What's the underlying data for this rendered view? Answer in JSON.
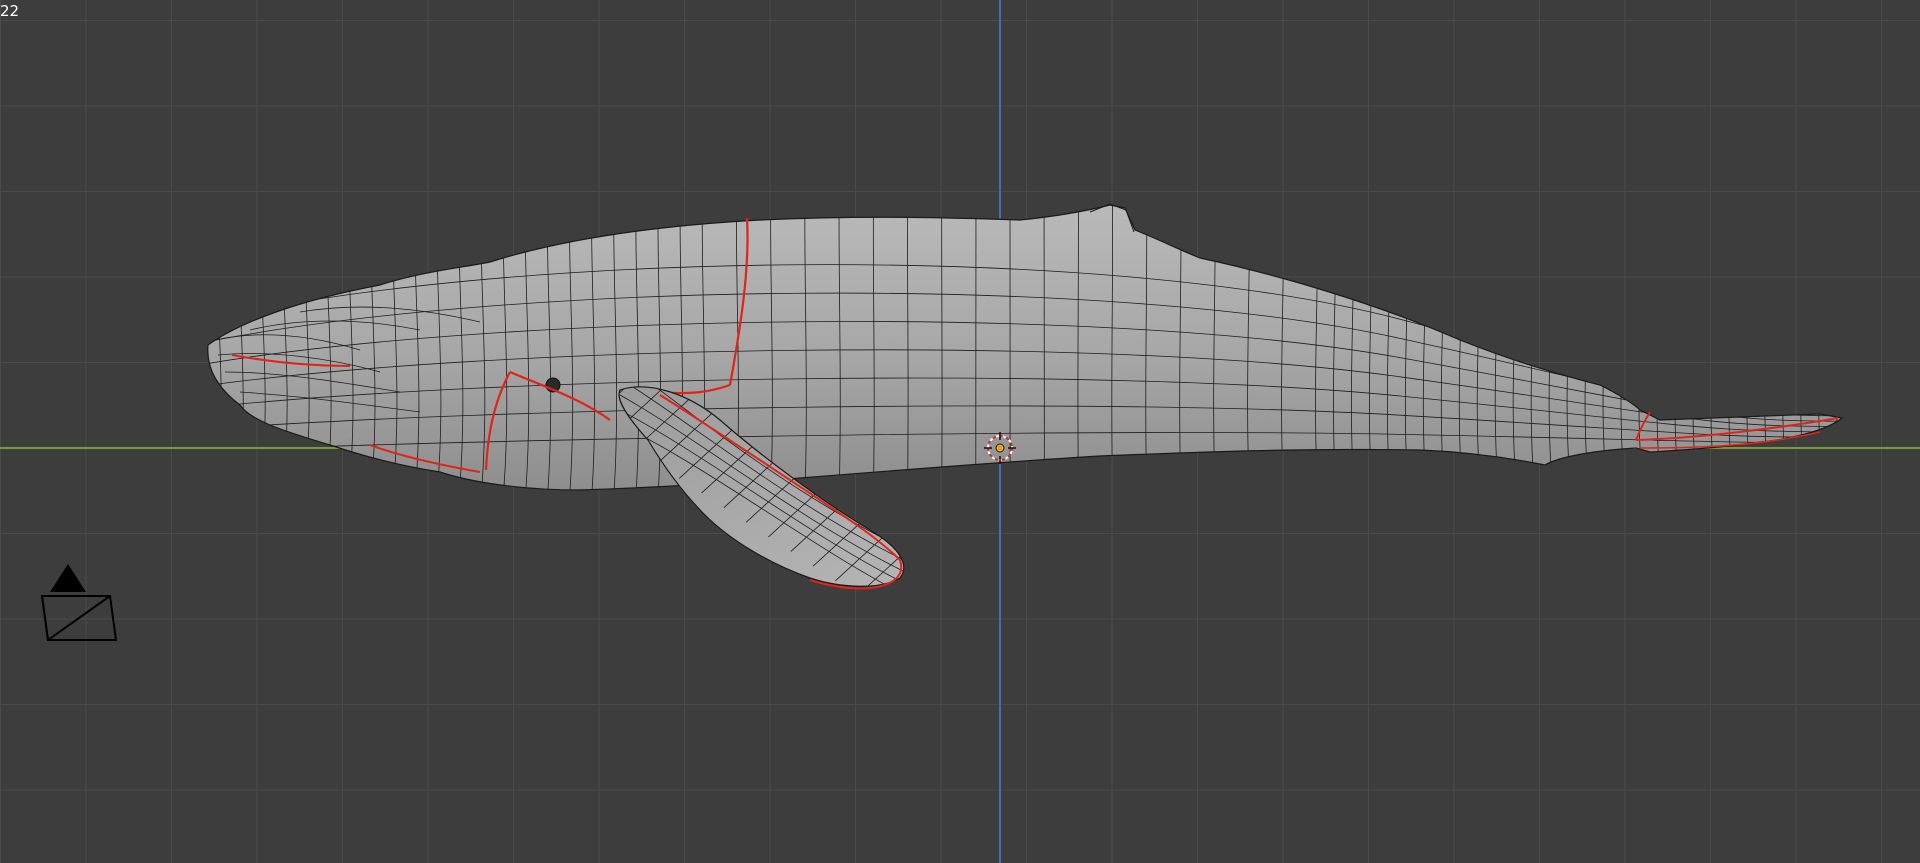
{
  "viewport": {
    "frame_label": "22",
    "colors": {
      "background": "#3d3d3d",
      "grid": "#4a4a4a",
      "x_axis": "#7d9a37",
      "z_axis": "#3f6fb0",
      "mesh_fill": "#a6a6a6",
      "mesh_wire": "#1a1a1a",
      "seam": "#e0241a"
    },
    "object": {
      "icon": "whale-mesh-icon"
    },
    "cursor": {
      "icon": "3d-cursor-icon"
    },
    "camera": {
      "icon": "camera-icon"
    }
  }
}
